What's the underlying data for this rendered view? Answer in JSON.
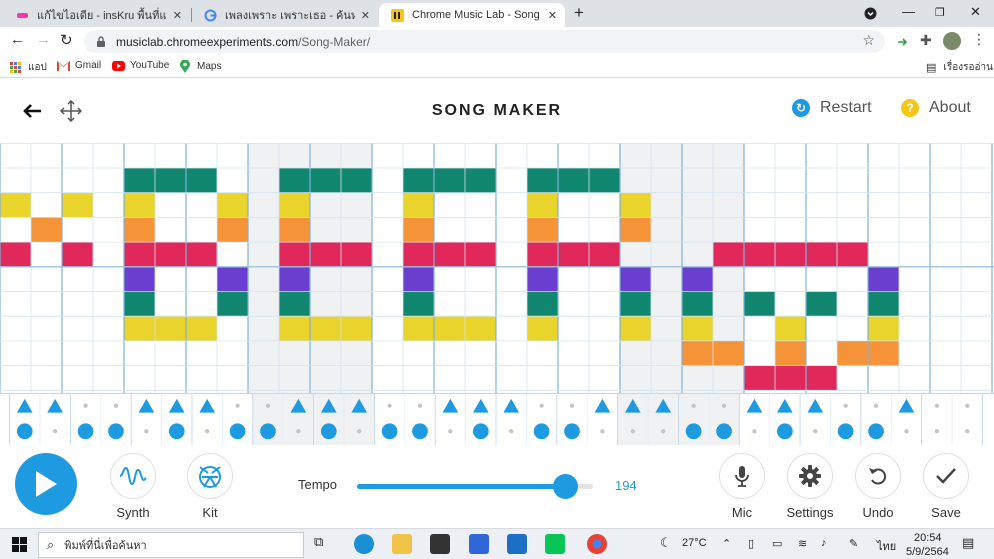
{
  "browser": {
    "tabs": [
      {
        "title": "แก้ไขไอเดีย - insKru พื้นที่แบ่งปันไอเดีย",
        "active": false
      },
      {
        "title": "เพลงเพราะ เพราะเธอ - ค้นหาด้วย Google",
        "active": false
      },
      {
        "title": "Chrome Music Lab - Song Maker",
        "active": true
      }
    ],
    "new_tab": "+",
    "url": {
      "host": "musiclab.chromeexperiments.com",
      "path": "/Song-Maker/"
    },
    "bookmarks": [
      {
        "label": "แอป",
        "icon": "apps-grid-icon"
      },
      {
        "label": "Gmail",
        "icon": "gmail-icon"
      },
      {
        "label": "YouTube",
        "icon": "youtube-icon"
      },
      {
        "label": "Maps",
        "icon": "maps-pin-icon"
      }
    ],
    "reading_list": "เรื่องรออ่าน"
  },
  "app": {
    "title": "SONG MAKER",
    "restart": "Restart",
    "about": "About",
    "about_glyph": "?",
    "controls": {
      "synth": "Synth",
      "kit": "Kit",
      "tempo_label": "Tempo",
      "tempo": 194,
      "tempo_fraction": 0.88,
      "mic": "Mic",
      "settings": "Settings",
      "undo": "Undo",
      "save": "Save"
    }
  },
  "colors": {
    "accent": "#1e9ae0",
    "restart": "#1e9ae0",
    "about": "#f5c518",
    "pitch": {
      "r1": "#10876e",
      "r2": "#e8d42a",
      "r3": "#f59339",
      "r4": "#e1285a",
      "r5": "#6a3fd0",
      "r6": "#10876e",
      "r7": "#e8d42a",
      "r8": "#f59339",
      "r9": "#e1285a"
    }
  },
  "notes": [
    {
      "row": 1,
      "cols": [
        4,
        5,
        6,
        9,
        10,
        11,
        13,
        14,
        15,
        17,
        18,
        19
      ]
    },
    {
      "row": 2,
      "cols": [
        0,
        2,
        4,
        7,
        9,
        13,
        17,
        20
      ]
    },
    {
      "row": 3,
      "cols": [
        1,
        4,
        7,
        9,
        13,
        17,
        20
      ]
    },
    {
      "row": 4,
      "cols": [
        0,
        2,
        4,
        5,
        6,
        9,
        10,
        11,
        13,
        14,
        15,
        17,
        18,
        19,
        23,
        24,
        25,
        26,
        27
      ]
    },
    {
      "row": 5,
      "cols": [
        4,
        7,
        9,
        13,
        17,
        20,
        22,
        28
      ]
    },
    {
      "row": 6,
      "cols": [
        4,
        7,
        9,
        13,
        17,
        20,
        22,
        24,
        26,
        28
      ]
    },
    {
      "row": 7,
      "cols": [
        4,
        5,
        6,
        9,
        10,
        11,
        13,
        14,
        15,
        17,
        20,
        22,
        25,
        28
      ]
    },
    {
      "row": 8,
      "cols": [
        22,
        23,
        25,
        27,
        28
      ]
    },
    {
      "row": 9,
      "cols": [
        24,
        25,
        26
      ]
    }
  ],
  "percussion": {
    "triangles": [
      0,
      1,
      4,
      5,
      6,
      9,
      10,
      11,
      14,
      15,
      16,
      19,
      20,
      21,
      24,
      25,
      26,
      29
    ],
    "circles": [
      0,
      2,
      3,
      5,
      7,
      8,
      10,
      12,
      13,
      15,
      17,
      18,
      22,
      23,
      25,
      27,
      28
    ]
  },
  "taskbar": {
    "search_placeholder": "พิมพ์ที่นี่เพื่อค้นหา",
    "weather": "27°C",
    "lang": "ไทย",
    "time": "20:54",
    "date": "5/9/2564"
  }
}
